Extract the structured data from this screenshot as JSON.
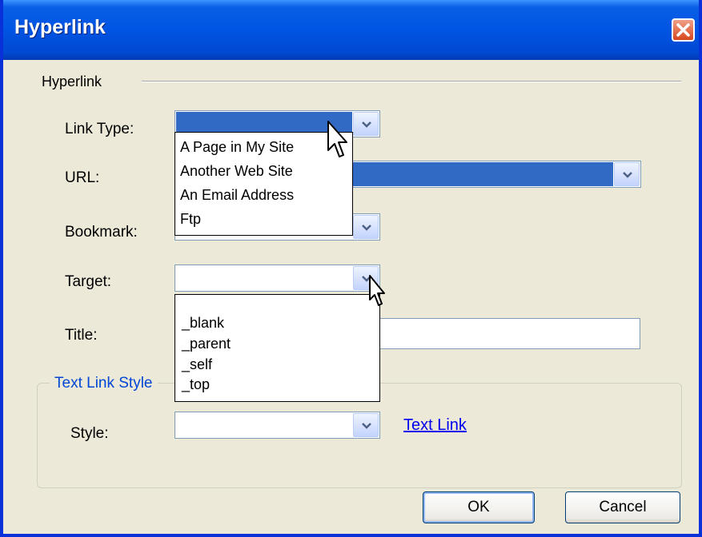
{
  "window": {
    "title": "Hyperlink"
  },
  "section": {
    "label": "Hyperlink"
  },
  "fields": {
    "link_type_label": "Link Type:",
    "url_label": "URL:",
    "bookmark_label": "Bookmark:",
    "target_label": "Target:",
    "title_label": "Title:",
    "title_value": ""
  },
  "link_type_options": [
    "A Page in My Site",
    "Another Web Site",
    "An Email Address",
    "Ftp"
  ],
  "target_options": [
    "_blank",
    "_parent",
    "_self",
    "_top"
  ],
  "text_link_style": {
    "legend": "Text Link Style",
    "style_label": "Style:",
    "preview_link": "Text Link"
  },
  "buttons": {
    "ok": "OK",
    "cancel": "Cancel"
  },
  "colors": {
    "titlebar": "#0054e3",
    "selection": "#316ac5",
    "link": "#0000ee",
    "legend": "#0046d5"
  }
}
